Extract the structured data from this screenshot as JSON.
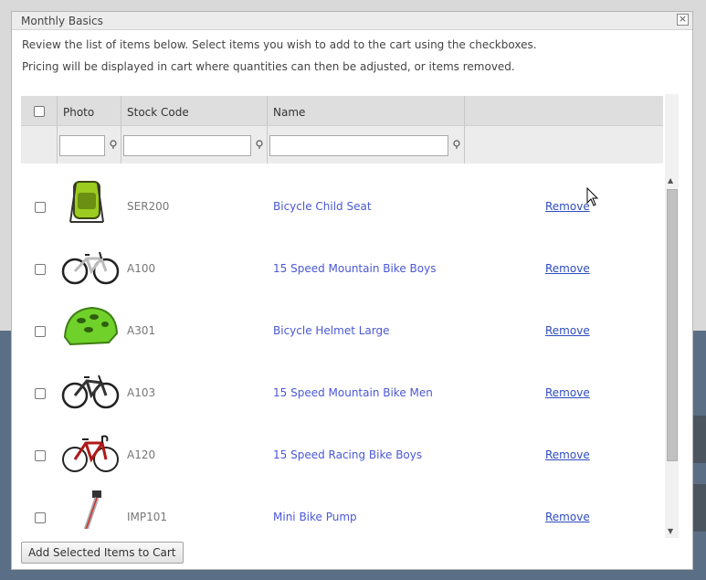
{
  "dialog": {
    "title": "Monthly Basics",
    "close_glyph": "×",
    "intro_line1": "Review the list of items below. Select items you wish to add to the cart using the checkboxes.",
    "intro_line2": "Pricing will be displayed in cart where quantities can then be adjusted, or items removed."
  },
  "table": {
    "columns": {
      "photo": "Photo",
      "stock_code": "Stock Code",
      "name": "Name"
    },
    "filters": {
      "photo": "",
      "stock_code": "",
      "name": ""
    },
    "rows": [
      {
        "code": "SER200",
        "name": "Bicycle Child Seat",
        "action": "Remove",
        "icon": "child-seat-icon"
      },
      {
        "code": "A100",
        "name": "15 Speed Mountain Bike Boys",
        "action": "Remove",
        "icon": "bike-icon"
      },
      {
        "code": "A301",
        "name": "Bicycle Helmet Large",
        "action": "Remove",
        "icon": "helmet-icon"
      },
      {
        "code": "A103",
        "name": "15 Speed Mountain Bike Men",
        "action": "Remove",
        "icon": "bike-icon"
      },
      {
        "code": "A120",
        "name": "15 Speed Racing Bike Boys",
        "action": "Remove",
        "icon": "racing-bike-icon"
      },
      {
        "code": "IMP101",
        "name": "Mini Bike Pump",
        "action": "Remove",
        "icon": "pump-icon"
      }
    ]
  },
  "footer": {
    "add_button_label": "Add Selected Items to Cart"
  },
  "colors": {
    "link": "#4a58d6",
    "remove_link": "#2e4cbf",
    "header_bg": "#dedede",
    "filter_bg": "#ececec"
  }
}
